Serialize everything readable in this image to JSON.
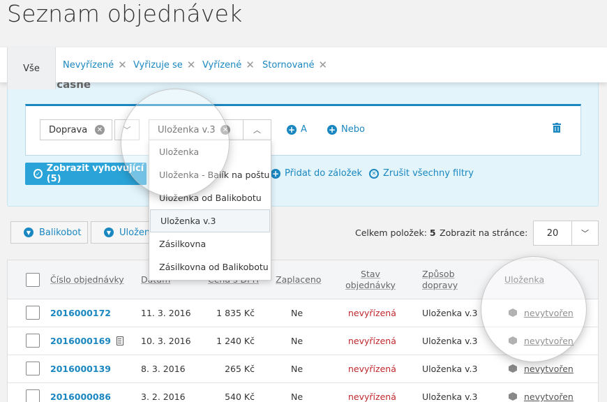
{
  "page": {
    "title": "Seznam objednávek"
  },
  "tabs": [
    {
      "label": "Vše",
      "closable": false,
      "active": true
    },
    {
      "label": "Nevyřízené",
      "closable": true
    },
    {
      "label": "Vyřizuje se",
      "closable": true
    },
    {
      "label": "Vyřízené",
      "closable": true
    },
    {
      "label": "Stornované",
      "closable": true
    }
  ],
  "filter": {
    "heading": "a současně",
    "field_value": "Doprava",
    "operator_value": "Uloženka v.3",
    "and_label": "A",
    "or_label": "Nebo",
    "show_button": "Zobrazit vyhovující (5)",
    "bookmark_label": "Přidat do záložek",
    "clear_label": "Zrušit všechny filtry",
    "dropdown_options": [
      "Uloženka",
      "Uloženka - Balík na poštu",
      "Uloženka od Balikobotu",
      "Uloženka v.3",
      "Zásilkovna",
      "Zásilkovna od Balikobotu"
    ],
    "highlighted_option": "Uloženka v.3"
  },
  "toolbar": {
    "chip_1": "Balikobot",
    "chip_2": "Uložen",
    "total_label": "Celkem položek:",
    "total_value": "5",
    "per_page_label": "Zobrazit na stránce:",
    "per_page_value": "20"
  },
  "table": {
    "headers": {
      "order": "Číslo objednávky",
      "date": "Datum",
      "price": "Cena s DPH",
      "paid": "Zaplaceno",
      "state": "Stav objednávky",
      "shipping": "Způsob dopravy",
      "ulozenka": "Uloženka"
    },
    "rows": [
      {
        "order": "2016000172",
        "date": "11. 3. 2016",
        "price": "1 835 Kč",
        "paid": "Ne",
        "state": "nevyřízená",
        "shipping": "Uloženka v.3",
        "ulozenka": "nevytvořen",
        "note": false
      },
      {
        "order": "2016000169",
        "date": "10. 3. 2016",
        "price": "1 240 Kč",
        "paid": "Ne",
        "state": "nevyřízená",
        "shipping": "Uloženka v.3",
        "ulozenka": "nevytvořen",
        "note": true
      },
      {
        "order": "2016000139",
        "date": "8. 3. 2016",
        "price": "265 Kč",
        "paid": "Ne",
        "state": "nevyřízená",
        "shipping": "Uloženka v.3",
        "ulozenka": "nevytvořen",
        "note": false
      },
      {
        "order": "2016000086",
        "date": "3. 2. 2016",
        "price": "540 Kč",
        "paid": "Ne",
        "state": "nevyřízená",
        "shipping": "Uloženka v.3",
        "ulozenka": "nevytvořen",
        "note": false
      }
    ]
  },
  "colors": {
    "accent": "#1a87c0",
    "button": "#2aa3d8",
    "panel": "#e3f4fb",
    "status_red": "#c0282d"
  }
}
